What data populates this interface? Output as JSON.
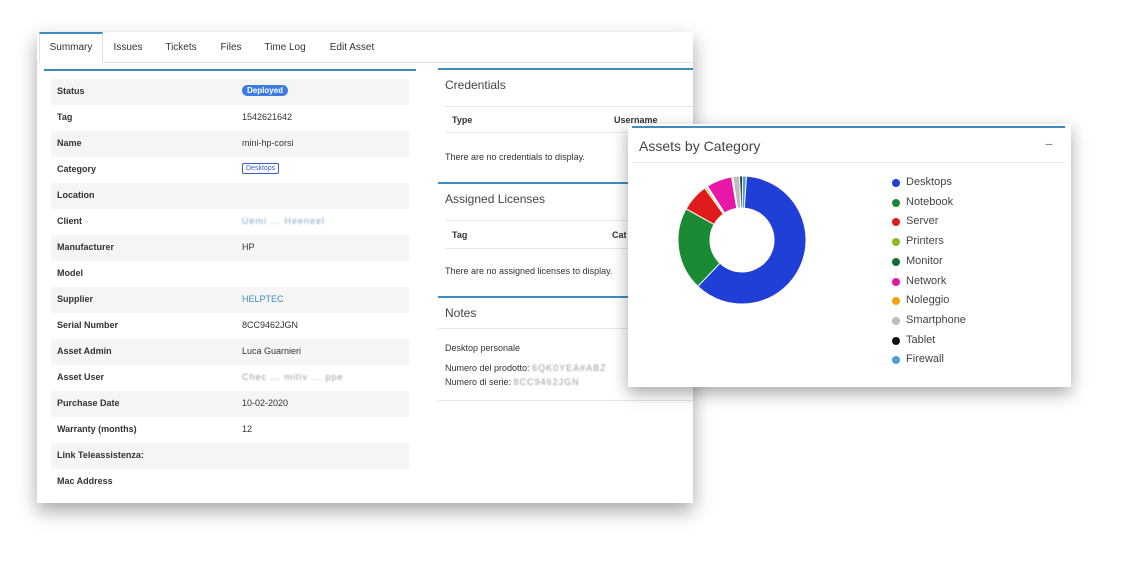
{
  "tabs": [
    {
      "label": "Summary",
      "active": true
    },
    {
      "label": "Issues"
    },
    {
      "label": "Tickets"
    },
    {
      "label": "Files"
    },
    {
      "label": "Time Log"
    },
    {
      "label": "Edit Asset"
    }
  ],
  "details": [
    {
      "label": "Status",
      "value": "Deployed",
      "kind": "badge"
    },
    {
      "label": "Tag",
      "value": "1542621642"
    },
    {
      "label": "Name",
      "value": "mini-hp-corsi"
    },
    {
      "label": "Category",
      "value": "Desktops",
      "kind": "outline"
    },
    {
      "label": "Location",
      "value": ""
    },
    {
      "label": "Client",
      "value": "Uemi ... Heeneel",
      "kind": "blurred"
    },
    {
      "label": "Manufacturer",
      "value": "HP"
    },
    {
      "label": "Model",
      "value": ""
    },
    {
      "label": "Supplier",
      "value": "HELPTEC",
      "kind": "link"
    },
    {
      "label": "Serial Number",
      "value": "8CC9462JGN"
    },
    {
      "label": "Asset Admin",
      "value": "Luca Guarnieri"
    },
    {
      "label": "Asset User",
      "value": "Chec ... mitiv ... ppe",
      "kind": "blurred"
    },
    {
      "label": "Purchase Date",
      "value": "10-02-2020"
    },
    {
      "label": "Warranty (months)",
      "value": "12"
    },
    {
      "label": "Link Teleassistenza:",
      "value": ""
    },
    {
      "label": "Mac Address",
      "value": ""
    }
  ],
  "credentials": {
    "title": "Credentials",
    "col_type": "Type",
    "col_username": "Username",
    "empty": "There are no credentials to display."
  },
  "licenses": {
    "title": "Assigned Licenses",
    "col_tag": "Tag",
    "col_cat": "Cat",
    "empty": "There are no assigned licenses to display."
  },
  "notes": {
    "title": "Notes",
    "line1": "Desktop personale",
    "line2_label": "Numero del prodotto:",
    "line2_value": "6QK0YEA#ABZ",
    "line3_label": "Numero di serie:",
    "line3_value": "8CC9462JGN"
  },
  "chart_panel": {
    "title": "Assets by Category",
    "collapse_symbol": "−"
  },
  "chart_data": {
    "type": "pie",
    "donut": true,
    "categories": [
      "Desktops",
      "Notebook",
      "Server",
      "Printers",
      "Monitor",
      "Network",
      "Noleggio",
      "Smartphone",
      "Tablet",
      "Firewall"
    ],
    "values": [
      61,
      21,
      7,
      0.5,
      0.3,
      6.5,
      0.3,
      1.7,
      0.7,
      1
    ],
    "colors": [
      "#1f3fd6",
      "#1a8a35",
      "#e01b1b",
      "#88b825",
      "#136b30",
      "#e817a8",
      "#f2a20f",
      "#bdbdbd",
      "#111111",
      "#4a9fd8"
    ],
    "legend_position": "right"
  }
}
